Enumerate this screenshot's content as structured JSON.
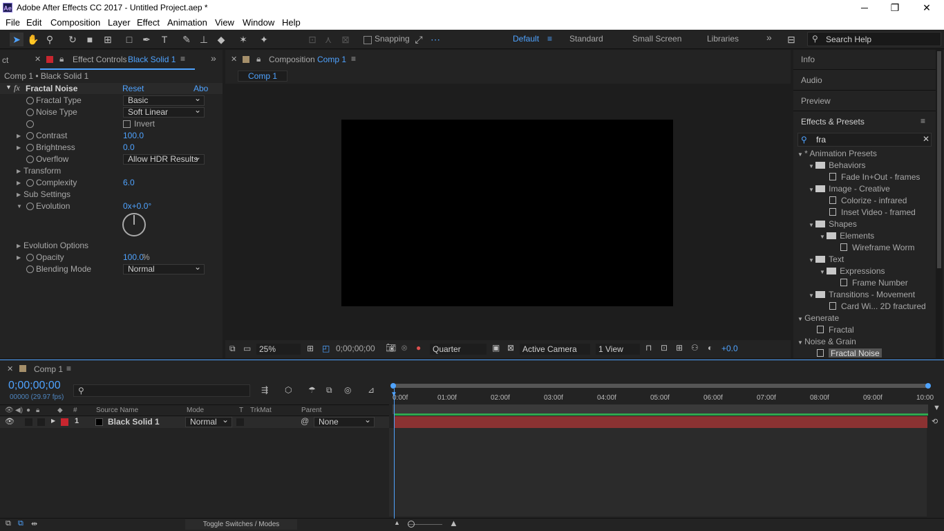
{
  "window": {
    "title": "Adobe After Effects CC 2017 - Untitled Project.aep *",
    "app_icon": "Ae",
    "minimize": "─",
    "maximize": "❐",
    "close": "✕"
  },
  "menus": [
    "File",
    "Edit",
    "Composition",
    "Layer",
    "Effect",
    "Animation",
    "View",
    "Window",
    "Help"
  ],
  "toolbar": {
    "snapping": "Snapping",
    "workspaces": [
      "Default",
      "Standard",
      "Small Screen",
      "Libraries"
    ],
    "more": "»",
    "search_placeholder": "Search Help"
  },
  "effect_controls": {
    "tab_label": "Effect Controls",
    "tab_target": "Black Solid 1",
    "left_tab": "ct",
    "breadcrumb": "Comp 1 • Black Solid 1",
    "effect": {
      "name": "Fractal Noise",
      "fx": "fx",
      "reset": "Reset",
      "about": "Abo"
    },
    "props": {
      "fractal_type": {
        "label": "Fractal Type",
        "value": "Basic"
      },
      "noise_type": {
        "label": "Noise Type",
        "value": "Soft Linear"
      },
      "invert": {
        "label": "Invert"
      },
      "contrast": {
        "label": "Contrast",
        "value": "100.0"
      },
      "brightness": {
        "label": "Brightness",
        "value": "0.0"
      },
      "overflow": {
        "label": "Overflow",
        "value": "Allow HDR Results"
      },
      "transform": {
        "label": "Transform"
      },
      "complexity": {
        "label": "Complexity",
        "value": "6.0"
      },
      "sub_settings": {
        "label": "Sub Settings"
      },
      "evolution": {
        "label": "Evolution",
        "value": "0x+0.0°"
      },
      "evolution_options": {
        "label": "Evolution Options"
      },
      "opacity": {
        "label": "Opacity",
        "value": "100.0",
        "unit": "%"
      },
      "blending_mode": {
        "label": "Blending Mode",
        "value": "Normal"
      }
    }
  },
  "composition": {
    "tab_label": "Composition",
    "tab_target": "Comp 1",
    "subtab": "Comp 1",
    "footer": {
      "zoom": "25%",
      "timecode": "0;00;00;00",
      "resolution": "Quarter",
      "camera": "Active Camera",
      "views": "1 View",
      "exposure": "+0.0"
    }
  },
  "right_panel": {
    "info": "Info",
    "audio": "Audio",
    "preview": "Preview",
    "effects_presets": "Effects & Presets",
    "search_value": "fra",
    "tree": {
      "animation_presets": "* Animation Presets",
      "behaviors": "Behaviors",
      "fade": "Fade In+Out - frames",
      "image_creative": "Image - Creative",
      "colorize": "Colorize - infrared",
      "inset": "Inset Video - framed",
      "shapes": "Shapes",
      "elements": "Elements",
      "wireframe": "Wireframe Worm",
      "text": "Text",
      "expressions": "Expressions",
      "frame_number": "Frame Number",
      "transitions": "Transitions - Movement",
      "card_wipe": "Card Wi... 2D fractured",
      "generate": "Generate",
      "fractal": "Fractal",
      "noise_grain": "Noise & Grain",
      "fractal_noise": "Fractal Noise"
    }
  },
  "timeline": {
    "tab_label": "Comp 1",
    "timecode": "0;00;00;00",
    "frame_info": "00000 (29.97 fps)",
    "columns": {
      "hash": "#",
      "source_name": "Source Name",
      "mode": "Mode",
      "t": "T",
      "trkmat": "TrkMat",
      "parent": "Parent"
    },
    "layer": {
      "number": "1",
      "name": "Black Solid 1",
      "mode": "Normal",
      "parent": "None"
    },
    "ticks": [
      "0:00f",
      "01:00f",
      "02:00f",
      "03:00f",
      "04:00f",
      "05:00f",
      "06:00f",
      "07:00f",
      "08:00f",
      "09:00f",
      "10:00"
    ],
    "toggle_label": "Toggle Switches / Modes"
  },
  "colors": {
    "accent": "#4fa3ff",
    "layer_bar": "#8b3232",
    "label_red": "#c8262f",
    "panel": "#232323",
    "background": "#1d1d1d"
  }
}
